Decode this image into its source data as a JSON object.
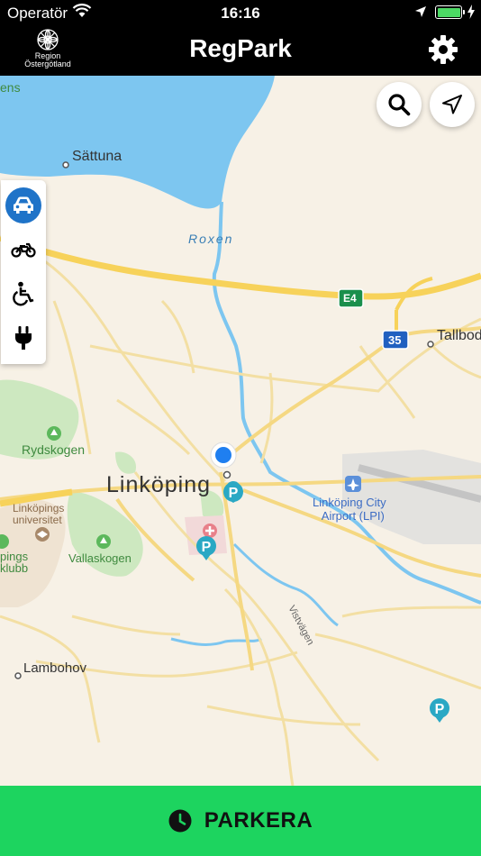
{
  "status_bar": {
    "carrier": "Operatör",
    "time": "16:16",
    "battery_level": 1.0,
    "battery_color": "#4cd964"
  },
  "header": {
    "title": "RegPark",
    "logo_line1": "Region",
    "logo_line2": "Östergötland",
    "settings_icon": "gear-icon"
  },
  "map": {
    "buttons": {
      "search_icon": "search-icon",
      "locate_icon": "location-arrow-icon"
    },
    "vehicle_types": [
      {
        "name": "car",
        "icon": "car-icon",
        "selected": true
      },
      {
        "name": "motorcycle",
        "icon": "motorcycle-icon",
        "selected": false
      },
      {
        "name": "disabled",
        "icon": "wheelchair-icon",
        "selected": false
      },
      {
        "name": "electric",
        "icon": "plug-icon",
        "selected": false
      }
    ],
    "labels": {
      "ens": "ens",
      "sattuna": "Sättuna",
      "roxen": "Roxen",
      "e4": "E4",
      "route35": "35",
      "tallbo": "Tallbod",
      "rydskogen": "Rydskogen",
      "linkoping": "Linköping",
      "airport_line1": "Linköping City",
      "airport_line2": "Airport (LPI)",
      "univ_line1": "Linköpings",
      "univ_line2": "universitet",
      "pings_line1": "pings",
      "pings_line2": "klubb",
      "vallaskogen": "Vallaskogen",
      "vistvagen": "Vistvägen",
      "lambohov": "Lambohov"
    },
    "colors": {
      "water": "#7dc6f0",
      "park": "#cde8c0",
      "road_major": "#f7d25a",
      "road_minor": "#f3dfa3",
      "parking_marker": "#2aa8c4",
      "user_location": "#1f7ff0"
    }
  },
  "action": {
    "label": "PARKERA",
    "icon": "clock-icon",
    "color": "#1dd45f"
  }
}
